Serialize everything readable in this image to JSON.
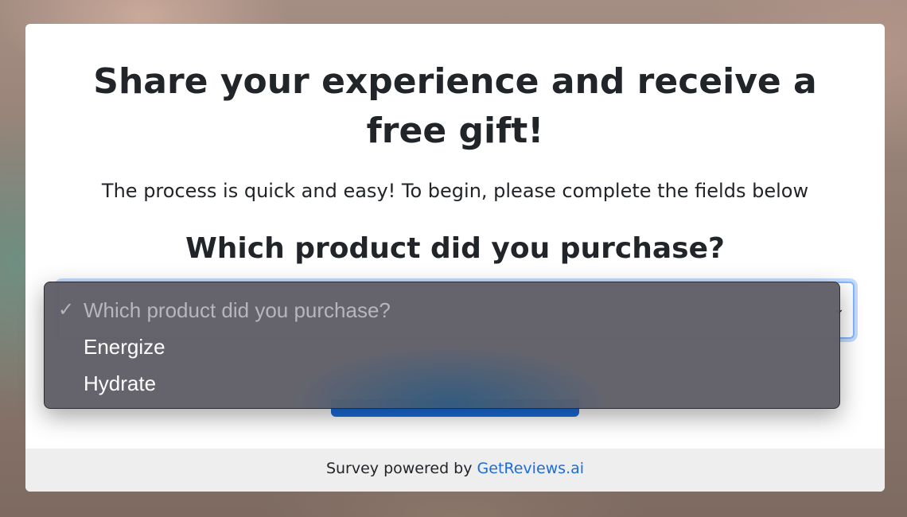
{
  "modal": {
    "title": "Share your experience and receive a free gift!",
    "subtitle": "The process is quick and easy! To begin, please complete the fields below",
    "question": "Which product did you purchase?"
  },
  "select": {
    "options": [
      {
        "label": "Which product did you purchase?",
        "selected": true,
        "placeholder": true
      },
      {
        "label": "Energize",
        "selected": false
      },
      {
        "label": "Hydrate",
        "selected": false
      }
    ],
    "checkmark": "✓",
    "focus_color": "#86b7fe"
  },
  "button": {
    "color": "#1a6ddb"
  },
  "footer": {
    "prefix": "Survey powered by",
    "link_text": "GetReviews.ai",
    "link_color": "#1a6ddb"
  }
}
